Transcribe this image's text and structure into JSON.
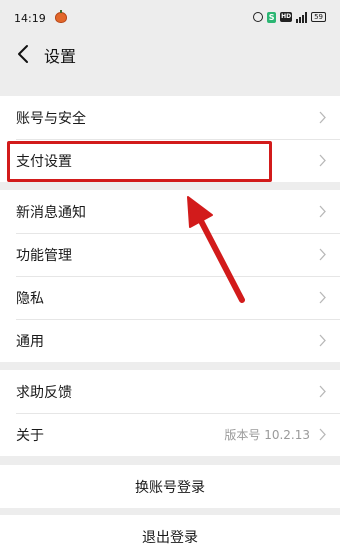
{
  "status_bar": {
    "time": "14:19",
    "battery": "59",
    "icons": [
      "pumpkin-icon",
      "alarm-icon",
      "s-app-icon",
      "hd-icon",
      "signal-icon",
      "battery-icon"
    ]
  },
  "header": {
    "title": "设置",
    "back_icon": "back-arrow-icon"
  },
  "groups": [
    {
      "items": [
        {
          "label": "账号与安全"
        },
        {
          "label": "支付设置",
          "highlighted": true
        }
      ]
    },
    {
      "items": [
        {
          "label": "新消息通知"
        },
        {
          "label": "功能管理"
        },
        {
          "label": "隐私"
        },
        {
          "label": "通用"
        }
      ]
    },
    {
      "items": [
        {
          "label": "求助反馈"
        },
        {
          "label": "关于",
          "value": "版本号 10.2.13"
        }
      ]
    }
  ],
  "actions": {
    "switch_account": "换账号登录",
    "logout": "退出登录"
  },
  "annotation": {
    "color": "#d21b1b",
    "shapes": [
      "highlight-box",
      "pointer-arrow"
    ]
  }
}
